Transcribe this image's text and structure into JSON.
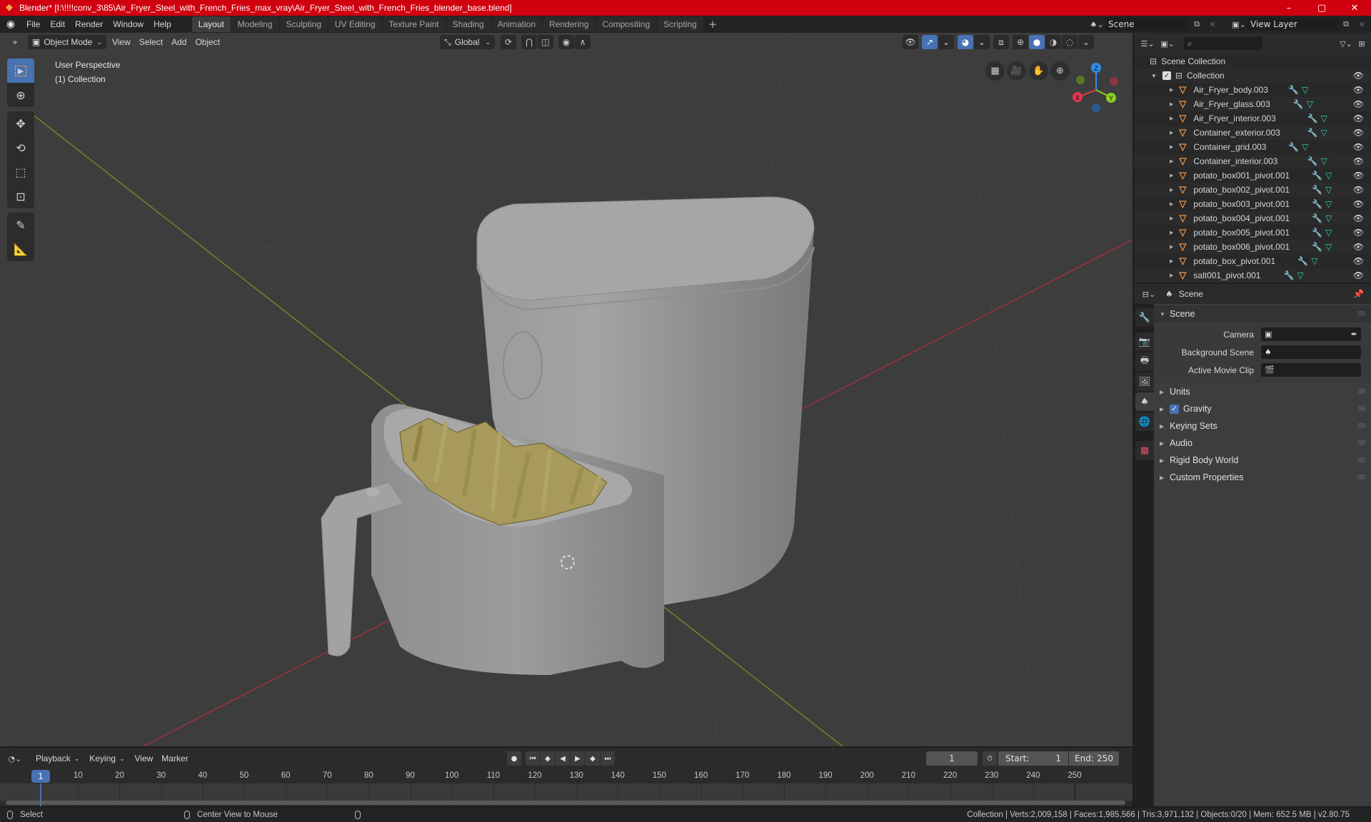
{
  "window": {
    "title": "Blender* [I:\\!!!!conv_3\\85\\Air_Fryer_Steel_with_French_Fries_max_vray\\Air_Fryer_Steel_with_French_Fries_blender_base.blend]",
    "minimize": "–",
    "maximize": "▢",
    "close": "✕"
  },
  "menubar": {
    "menus": [
      "File",
      "Edit",
      "Render",
      "Window",
      "Help"
    ],
    "workspaces": [
      "Layout",
      "Modeling",
      "Sculpting",
      "UV Editing",
      "Texture Paint",
      "Shading",
      "Animation",
      "Rendering",
      "Compositing",
      "Scripting"
    ],
    "active_workspace": "Layout",
    "add_workspace": "+",
    "scene": "Scene",
    "view_layer": "View Layer"
  },
  "viewport": {
    "mode": "Object Mode",
    "menus": [
      "View",
      "Select",
      "Add",
      "Object"
    ],
    "transform_orientation": "Global",
    "overlay_title": "User Perspective",
    "overlay_subtitle": "(1) Collection",
    "gizmo": {
      "x": "X",
      "y": "Y",
      "z": "Z"
    },
    "colors": {
      "x_axis": "#e8334d",
      "y_axis": "#8bcc1f",
      "z_axis": "#2e8ef0",
      "active": "#4772b3"
    }
  },
  "outliner": {
    "search_placeholder": "",
    "root": "Scene Collection",
    "collection": "Collection",
    "objects": [
      "Air_Fryer_body.003",
      "Air_Fryer_glass.003",
      "Air_Fryer_interior.003",
      "Container_exterior.003",
      "Container_grid.003",
      "Container_interior.003",
      "potato_box001_pivot.001",
      "potato_box002_pivot.001",
      "potato_box003_pivot.001",
      "potato_box004_pivot.001",
      "potato_box005_pivot.001",
      "potato_box006_pivot.001",
      "potato_box_pivot.001",
      "salt001_pivot.001"
    ]
  },
  "properties": {
    "context": "Scene",
    "panel_title": "Scene",
    "fields": [
      {
        "label": "Camera",
        "value": ""
      },
      {
        "label": "Background Scene",
        "value": ""
      },
      {
        "label": "Active Movie Clip",
        "value": ""
      }
    ],
    "panels": [
      "Units",
      "Gravity",
      "Keying Sets",
      "Audio",
      "Rigid Body World",
      "Custom Properties"
    ],
    "gravity_enabled": true
  },
  "timeline": {
    "menus": [
      "Playback",
      "Keying",
      "View",
      "Marker"
    ],
    "current_frame": "1",
    "start_label": "Start:",
    "start": "1",
    "end_label": "End:",
    "end": "250",
    "ticks": [
      "10",
      "20",
      "30",
      "40",
      "50",
      "60",
      "70",
      "80",
      "90",
      "100",
      "110",
      "120",
      "130",
      "140",
      "150",
      "160",
      "170",
      "180",
      "190",
      "200",
      "210",
      "220",
      "230",
      "240",
      "250"
    ],
    "playhead": "1"
  },
  "statusbar": {
    "left_action": "Select",
    "middle_action": "Center View to Mouse",
    "stats": "Collection | Verts:2,009,158 | Faces:1,985,566 | Tris:3,971,132 | Objects:0/20 | Mem: 652.5 MB | v2.80.75"
  }
}
